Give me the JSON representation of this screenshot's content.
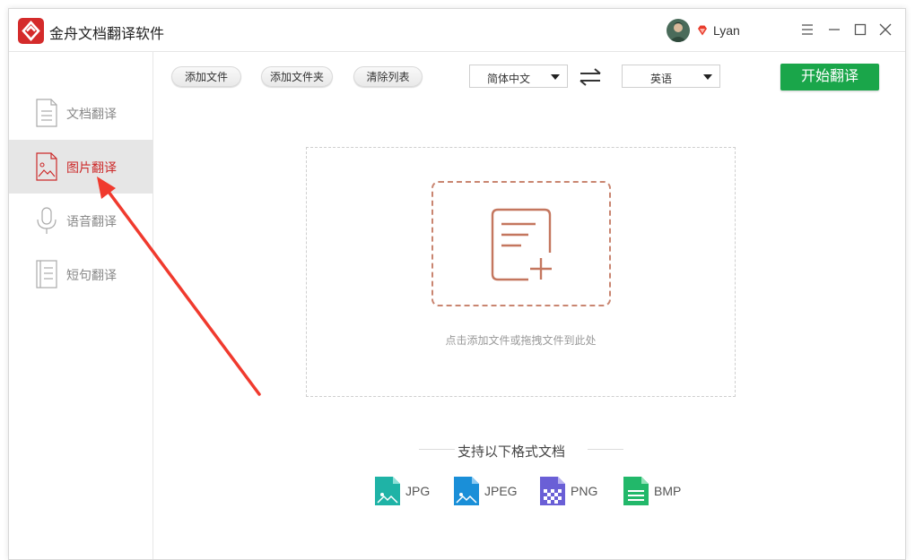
{
  "app": {
    "title": "金舟文档翻译软件"
  },
  "user": {
    "name": "Lyan"
  },
  "sidebar": {
    "items": [
      {
        "label": "文档翻译",
        "icon": "document-icon"
      },
      {
        "label": "图片翻译",
        "icon": "image-file-icon",
        "active": true
      },
      {
        "label": "语音翻译",
        "icon": "microphone-icon"
      },
      {
        "label": "短句翻译",
        "icon": "text-file-icon"
      }
    ]
  },
  "toolbar": {
    "add_file": "添加文件",
    "add_folder": "添加文件夹",
    "clear_list": "清除列表",
    "source_lang": "简体中文",
    "target_lang": "英语",
    "start": "开始翻译"
  },
  "dropzone": {
    "hint": "点击添加文件或拖拽文件到此处"
  },
  "formats": {
    "title": "支持以下格式文档",
    "items": [
      "JPG",
      "JPEG",
      "PNG",
      "BMP"
    ]
  },
  "colors": {
    "accent_green": "#1aa64a",
    "active_red": "#cc2a2a",
    "annotation_arrow": "#f03a2e"
  }
}
